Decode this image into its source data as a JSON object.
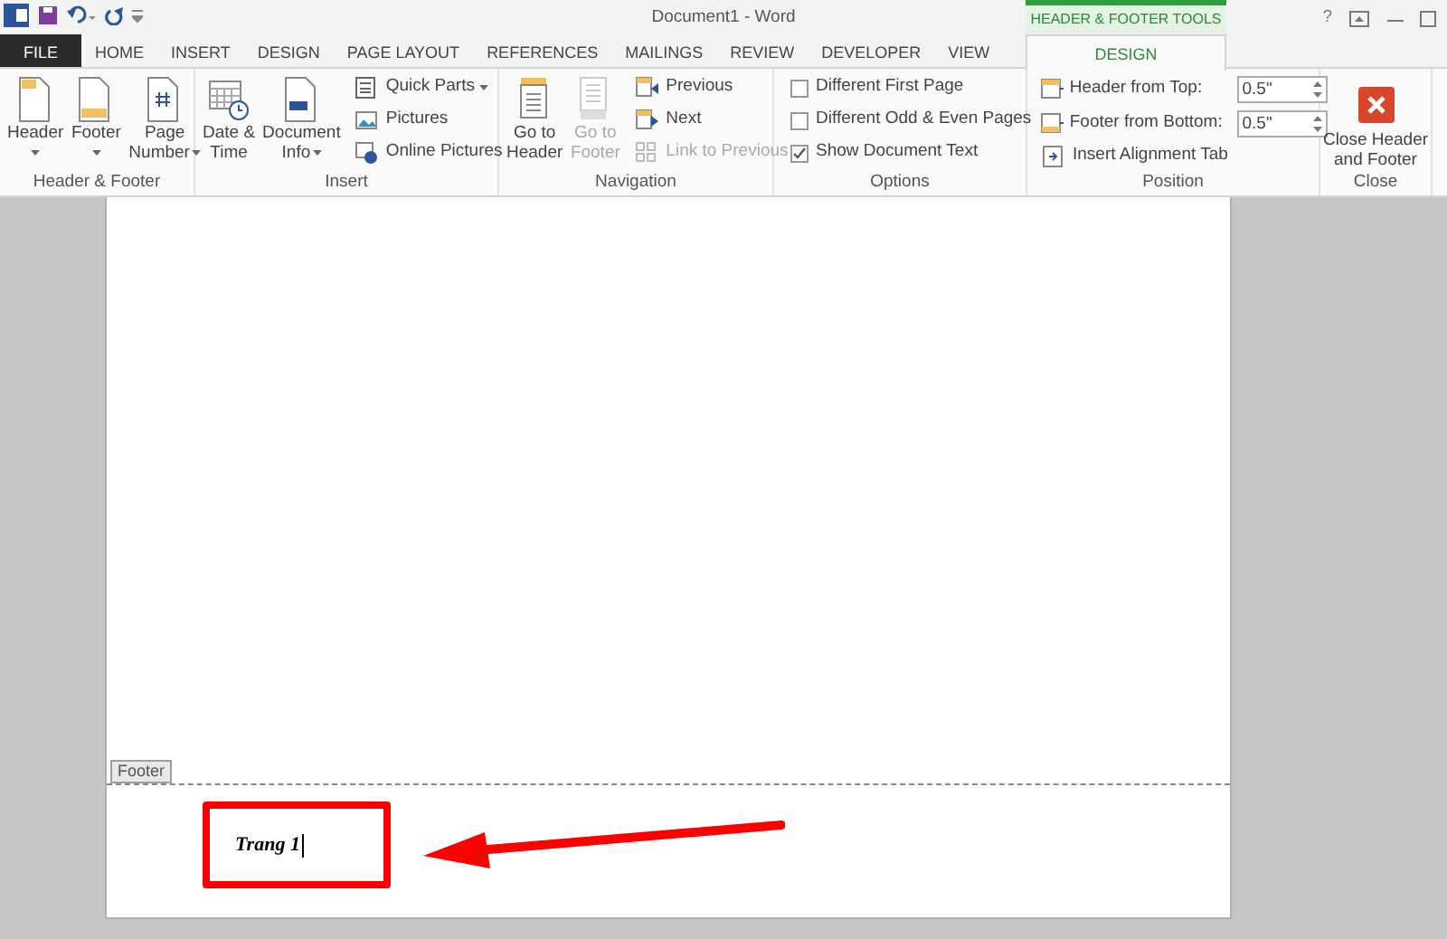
{
  "window": {
    "title": "Document1 - Word",
    "context_tab_group": "HEADER & FOOTER TOOLS",
    "controls": [
      "?"
    ]
  },
  "tabs": [
    {
      "label": "FILE",
      "kind": "file",
      "selected": false
    },
    {
      "label": "HOME",
      "kind": "normal",
      "selected": false
    },
    {
      "label": "INSERT",
      "kind": "normal",
      "selected": false
    },
    {
      "label": "DESIGN",
      "kind": "normal",
      "selected": false
    },
    {
      "label": "PAGE LAYOUT",
      "kind": "normal",
      "selected": false
    },
    {
      "label": "REFERENCES",
      "kind": "normal",
      "selected": false
    },
    {
      "label": "MAILINGS",
      "kind": "normal",
      "selected": false
    },
    {
      "label": "REVIEW",
      "kind": "normal",
      "selected": false
    },
    {
      "label": "DEVELOPER",
      "kind": "normal",
      "selected": false
    },
    {
      "label": "VIEW",
      "kind": "normal",
      "selected": false
    },
    {
      "label": "DESIGN",
      "kind": "contextual",
      "selected": true
    }
  ],
  "ribbon": [
    {
      "label": "Header & Footer",
      "items": [
        {
          "kind": "large",
          "lines": [
            "Header"
          ],
          "dropdown": true,
          "disabled": false
        },
        {
          "kind": "large",
          "lines": [
            "Footer"
          ],
          "dropdown": true,
          "disabled": false
        },
        {
          "kind": "large",
          "lines": [
            "Page",
            "Number"
          ],
          "dropdown": true,
          "disabled": false
        }
      ]
    },
    {
      "label": "Insert",
      "items": [
        {
          "kind": "large",
          "lines": [
            "Date &",
            "Time"
          ],
          "dropdown": false,
          "disabled": false
        },
        {
          "kind": "large",
          "lines": [
            "Document",
            "Info"
          ],
          "dropdown": true,
          "disabled": false
        },
        {
          "kind": "small",
          "label": "Quick Parts",
          "dropdown": true,
          "disabled": false
        },
        {
          "kind": "small",
          "label": "Pictures",
          "dropdown": false,
          "disabled": false
        },
        {
          "kind": "small",
          "label": "Online Pictures",
          "dropdown": false,
          "disabled": false
        }
      ]
    },
    {
      "label": "Navigation",
      "items": [
        {
          "kind": "large",
          "lines": [
            "Go to",
            "Header"
          ],
          "dropdown": false,
          "disabled": false
        },
        {
          "kind": "large",
          "lines": [
            "Go to",
            "Footer"
          ],
          "dropdown": false,
          "disabled": true
        },
        {
          "kind": "small",
          "label": "Previous",
          "dropdown": false,
          "disabled": false
        },
        {
          "kind": "small",
          "label": "Next",
          "dropdown": false,
          "disabled": false
        },
        {
          "kind": "small",
          "label": "Link to Previous",
          "dropdown": false,
          "disabled": true
        }
      ]
    },
    {
      "label": "Options",
      "items": [
        {
          "kind": "checkbox",
          "label": "Different First Page",
          "checked": false
        },
        {
          "kind": "checkbox",
          "label": "Different Odd & Even Pages",
          "checked": false
        },
        {
          "kind": "checkbox",
          "label": "Show Document Text",
          "checked": true
        }
      ]
    },
    {
      "label": "Position",
      "items": [
        {
          "kind": "spin",
          "label": "Header from Top:",
          "value": "0.5\""
        },
        {
          "kind": "spin",
          "label": "Footer from Bottom:",
          "value": "0.5\""
        },
        {
          "kind": "small",
          "label": "Insert Alignment Tab",
          "dropdown": false,
          "disabled": false
        }
      ]
    },
    {
      "label": "Close",
      "items": [
        {
          "kind": "close",
          "lines": [
            "Close Header",
            "and Footer"
          ]
        }
      ]
    }
  ],
  "document": {
    "footer_tag": "Footer",
    "footer_text": "Trang 1"
  }
}
